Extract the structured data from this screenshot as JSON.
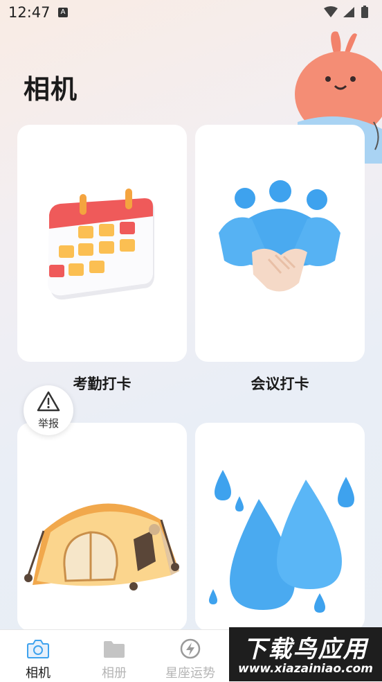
{
  "status_bar": {
    "time": "12:47",
    "notification_badge": "A"
  },
  "page": {
    "title": "相机"
  },
  "cards": [
    {
      "label": "考勤打卡",
      "icon": "calendar-icon"
    },
    {
      "label": "会议打卡",
      "icon": "handshake-icon"
    },
    {
      "label": "",
      "icon": "tent-icon"
    },
    {
      "label": "",
      "icon": "water-drops-icon"
    }
  ],
  "report_button": {
    "label": "举报",
    "icon": "warning-icon"
  },
  "bottom_nav": {
    "items": [
      {
        "label": "相机",
        "icon": "camera-icon",
        "active": true
      },
      {
        "label": "相册",
        "icon": "folder-icon",
        "active": false
      },
      {
        "label": "星座运势",
        "icon": "lightning-icon",
        "active": false
      }
    ]
  },
  "watermark": {
    "title": "下载鸟应用",
    "url": "www.xiazainiao.com"
  },
  "colors": {
    "active_nav": "#1a1a1a",
    "inactive_nav": "#b5b5b5",
    "accent_blue": "#3ea2ee",
    "calendar_red": "#ef5a5a",
    "calendar_yellow": "#fbbf52"
  }
}
